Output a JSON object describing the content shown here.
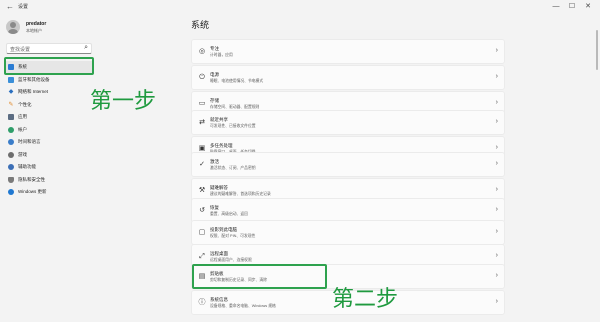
{
  "window": {
    "back_glyph": "←",
    "title": "设置",
    "minimize": "—",
    "maximize": "☐",
    "close": "✕"
  },
  "profile": {
    "name": "predator",
    "subtitle": "本地帐户"
  },
  "search": {
    "placeholder": "查找设置",
    "icon": "search-icon"
  },
  "sidebar": {
    "items": [
      {
        "label": "系统",
        "icon": "monitor-icon",
        "color": "#2b7cd3",
        "active": true
      },
      {
        "label": "蓝牙和其他设备",
        "icon": "bluetooth-devices-icon",
        "color": "#3a8fd8"
      },
      {
        "label": "网络和 Internet",
        "icon": "wifi-icon",
        "color": "#2a6fbf"
      },
      {
        "label": "个性化",
        "icon": "brush-icon",
        "color": "#e0892a"
      },
      {
        "label": "应用",
        "icon": "apps-icon",
        "color": "#5b6c82"
      },
      {
        "label": "帐户",
        "icon": "account-icon",
        "color": "#2f9e6a"
      },
      {
        "label": "时间和语言",
        "icon": "clock-globe-icon",
        "color": "#3a7dc9"
      },
      {
        "label": "游戏",
        "icon": "gamepad-icon",
        "color": "#6d6d6d"
      },
      {
        "label": "辅助功能",
        "icon": "accessibility-icon",
        "color": "#3c6fb6"
      },
      {
        "label": "隐私和安全性",
        "icon": "shield-icon",
        "color": "#7a7a7a"
      },
      {
        "label": "Windows 更新",
        "icon": "update-icon",
        "color": "#1f78d1"
      }
    ]
  },
  "annotations": {
    "step1": "第一步",
    "step2": "第二步",
    "color": "#2ea24e"
  },
  "main": {
    "title": "系统",
    "cards": [
      {
        "title": "专注",
        "subtitle": "计时器，应用",
        "icon": "focus-icon",
        "glyph": "◎"
      },
      {
        "title": "电源",
        "subtitle": "睡眠、电池使用情况、节电模式",
        "icon": "power-icon",
        "glyph": "⏻"
      },
      {
        "title": "存储",
        "subtitle": "存储空间、驱动器、配置规则",
        "icon": "storage-icon",
        "glyph": "▭"
      },
      {
        "title": "就近共享",
        "subtitle": "可发现性、已接收文件位置",
        "icon": "nearby-share-icon",
        "glyph": "⇄"
      },
      {
        "title": "多任务处理",
        "subtitle": "贴靠窗口、桌面、任务切换",
        "icon": "multitasking-icon",
        "glyph": "▣"
      },
      {
        "title": "激活",
        "subtitle": "激活状态、订阅、产品密钥",
        "icon": "activation-icon",
        "glyph": "✓"
      },
      {
        "title": "疑难解答",
        "subtitle": "建议的疑难解答、首选项和历史记录",
        "icon": "troubleshoot-icon",
        "glyph": "⚒"
      },
      {
        "title": "恢复",
        "subtitle": "重置、高级启动、返回",
        "icon": "recovery-icon",
        "glyph": "↺"
      },
      {
        "title": "投影到此电脑",
        "subtitle": "权限、配对 PIN、可发现性",
        "icon": "projection-icon",
        "glyph": "▢"
      },
      {
        "title": "远程桌面",
        "subtitle": "远程桌面用户、连接权限",
        "icon": "remote-desktop-icon",
        "glyph": "⤢"
      },
      {
        "title": "剪贴板",
        "subtitle": "剪切和复制历史记录、同步、清除",
        "icon": "clipboard-icon",
        "glyph": "📋"
      },
      {
        "title": "系统信息",
        "subtitle": "设备规格、重命名电脑、Windows 规格",
        "icon": "info-icon",
        "glyph": "ⓘ"
      }
    ],
    "chevron": "›"
  }
}
